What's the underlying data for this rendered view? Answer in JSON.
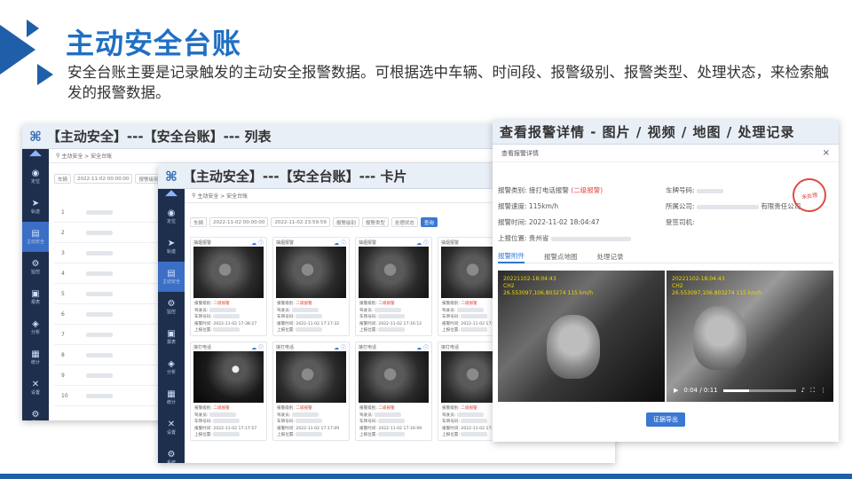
{
  "slide": {
    "title": "主动安全台账",
    "description": "安全台账主要是记录触发的主动安全报警数据。可根据选中车辆、时间段、报警级别、报警类型、处理状态，来检索触发的报警数据。"
  },
  "nav": {
    "items": [
      {
        "icon": "◉",
        "label": "定位"
      },
      {
        "icon": "➤",
        "label": "轨迹"
      },
      {
        "icon": "▤",
        "label": "主动安全"
      },
      {
        "icon": "⚙",
        "label": "监控"
      },
      {
        "icon": "▣",
        "label": "报表"
      },
      {
        "icon": "◈",
        "label": "分析"
      },
      {
        "icon": "▦",
        "label": "统计"
      },
      {
        "icon": "✕",
        "label": "设置"
      },
      {
        "icon": "⚙",
        "label": "系统"
      }
    ]
  },
  "list_window": {
    "caption": "【主动安全】---【安全台账】--- 列表",
    "breadcrumb": "主动安全 > 安全台账",
    "filters": [
      "车辆",
      "2022-11-02 00:00:00",
      "报警级别",
      "报警类型",
      "处理状态",
      "查询"
    ],
    "rows": [
      {
        "no": "1"
      },
      {
        "no": "2"
      },
      {
        "no": "3"
      },
      {
        "no": "4"
      },
      {
        "no": "5"
      },
      {
        "no": "6"
      },
      {
        "no": "7"
      },
      {
        "no": "8"
      },
      {
        "no": "9"
      },
      {
        "no": "10"
      }
    ]
  },
  "card_window": {
    "caption": "【主动安全】---【安全台账】--- 卡片",
    "breadcrumb": "主动安全 > 安全台账",
    "filters": [
      "车辆",
      "2022-11-02 00:00:00",
      "2022-11-02 23:59:59",
      "报警级别",
      "报警类型",
      "处理状态",
      "查询"
    ],
    "cards": [
      {
        "type": "抽烟报警",
        "level": "二级报警"
      },
      {
        "type": "抽烟报警",
        "level": "二级报警"
      },
      {
        "type": "抽烟报警",
        "level": "二级报警"
      },
      {
        "type": "抽烟报警",
        "level": "二级报警"
      },
      {
        "type": "接打电话",
        "level": "二级报警"
      },
      {
        "type": "接打电话",
        "level": "二级报警"
      },
      {
        "type": "接打电话",
        "level": "二级报警"
      },
      {
        "type": "接打电话",
        "level": "二级报警"
      }
    ],
    "card_labels": {
      "level": "报警级别:",
      "driver": "驾驶员:",
      "plate": "车牌号码:",
      "time": "报警时间:",
      "location": "上报位置:"
    },
    "card_times": [
      "2022-11-02 17:38:27",
      "2022-11-02 17:17:32",
      "2022-11-02 17:16:12",
      "2022-11-02 17:09:45",
      "2022-11-02 17:17:57",
      "2022-11-02 17:17:09",
      "2022-11-02 17:16:09",
      "2022-11-02 17:07:33"
    ]
  },
  "detail_window": {
    "caption": "查看报警详情 - 图片 / 视频 / 地图 /  处理记录",
    "subtitle": "查看报警详情",
    "close": "×",
    "alarm_type_label": "报警类别:",
    "alarm_type_value": "接打电话报警",
    "alarm_level": "(二级报警)",
    "plate_label": "车牌号码:",
    "speed_label": "报警速度:",
    "speed_value": "115km/h",
    "company_label": "所属公司:",
    "company_suffix": "有限责任公司",
    "time_label": "报警时间:",
    "time_value": "2022-11-02 18:04:47",
    "driver_label": "登签司机:",
    "location_label": "上报位置:",
    "location_value": "贵州省",
    "seal_text": "未处理",
    "tabs": [
      "报警附件",
      "报警点地图",
      "处理记录"
    ],
    "photo_ts_line1": "20221102-18:04:43",
    "photo_ts_line2": "CH2",
    "photo_ts_line3": "26.553097,106.803274 115 km/h",
    "video_ts_line1": "20221102-18:04:43",
    "video_ts_line2": "CH2",
    "video_ts_line3": "26.553097,106.803274  115 km/h",
    "video_time": "0:04 / 0:11",
    "video_progress": 0.36,
    "export_label": "证据导出"
  }
}
